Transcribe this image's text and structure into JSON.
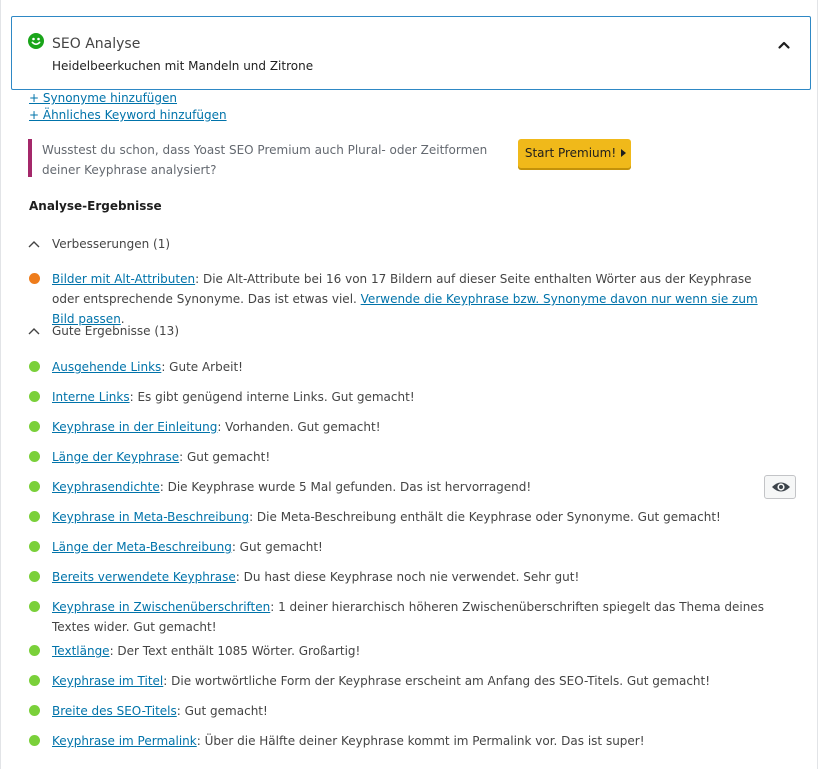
{
  "header": {
    "title": "SEO Analyse",
    "subtitle": "Heidelbeerkuchen mit Mandeln und Zitrone",
    "status_color": "#1aa51a"
  },
  "add_links": {
    "synonyms": "+ Synonyme hinzufügen",
    "related_keyword": "+ Ähnliches Keyword hinzufügen"
  },
  "upsell": {
    "text": "Wusstest du schon, dass Yoast SEO Premium auch Plural- oder Zeitformen deiner Keyphrase analysiert?",
    "button_label": "Start Premium!",
    "accent_color": "#a4286a",
    "button_color": "#f0b91a"
  },
  "results_heading": "Analyse-Ergebnisse",
  "improvements": {
    "label": "Verbesserungen (1)",
    "items": [
      {
        "link": "Bilder mit Alt-Attributen",
        "text": ": Die Alt-Attribute bei 16 von 17 Bildern auf dieser Seite enthalten Wörter aus der Keyphrase oder entsprechende Synonyme. Das ist etwas viel. ",
        "link2": "Verwende die Keyphrase bzw. Synonyme davon nur wenn sie zum Bild passen",
        "tail": ".",
        "color": "#ee7c1b"
      }
    ]
  },
  "good": {
    "label": "Gute Ergebnisse (13)",
    "color": "#7ad03a",
    "items": [
      {
        "link": "Ausgehende Links",
        "text": ": Gute Arbeit!"
      },
      {
        "link": "Interne Links",
        "text": ": Es gibt genügend interne Links. Gut gemacht!"
      },
      {
        "link": "Keyphrase in der Einleitung",
        "text": ": Vorhanden. Gut gemacht!"
      },
      {
        "link": "Länge der Keyphrase",
        "text": ": Gut gemacht!"
      },
      {
        "link": "Keyphrasendichte",
        "text": ": Die Keyphrase wurde 5 Mal gefunden. Das ist hervorragend!"
      },
      {
        "link": "Keyphrase in Meta-Beschreibung",
        "text": ": Die Meta-Beschreibung enthält die Keyphrase oder Synonyme. Gut gemacht!"
      },
      {
        "link": "Länge der Meta-Beschreibung",
        "text": ": Gut gemacht!"
      },
      {
        "link": "Bereits verwendete Keyphrase",
        "text": ": Du hast diese Keyphrase noch nie verwendet. Sehr gut!"
      },
      {
        "link": "Keyphrase in Zwischenüberschriften",
        "text": ": 1 deiner hierarchisch höheren Zwischenüberschriften spiegelt das Thema deines Textes wider. Gut gemacht!"
      },
      {
        "link": "Textlänge",
        "text": ": Der Text enthält 1085 Wörter. Großartig!"
      },
      {
        "link": "Keyphrase im Titel",
        "text": ": Die wortwörtliche Form der Keyphrase erscheint am Anfang des SEO-Titels. Gut gemacht!"
      },
      {
        "link": "Breite des SEO-Titels",
        "text": ": Gut gemacht!"
      },
      {
        "link": "Keyphrase im Permalink",
        "text": ": Über die Hälfte deiner Keyphrase kommt im Permalink vor. Das ist super!"
      }
    ]
  },
  "icons": {
    "status": "smiley-face-icon",
    "collapse": "chevron-up-icon",
    "section": "chevron-up-icon",
    "marker": "eye-icon"
  }
}
